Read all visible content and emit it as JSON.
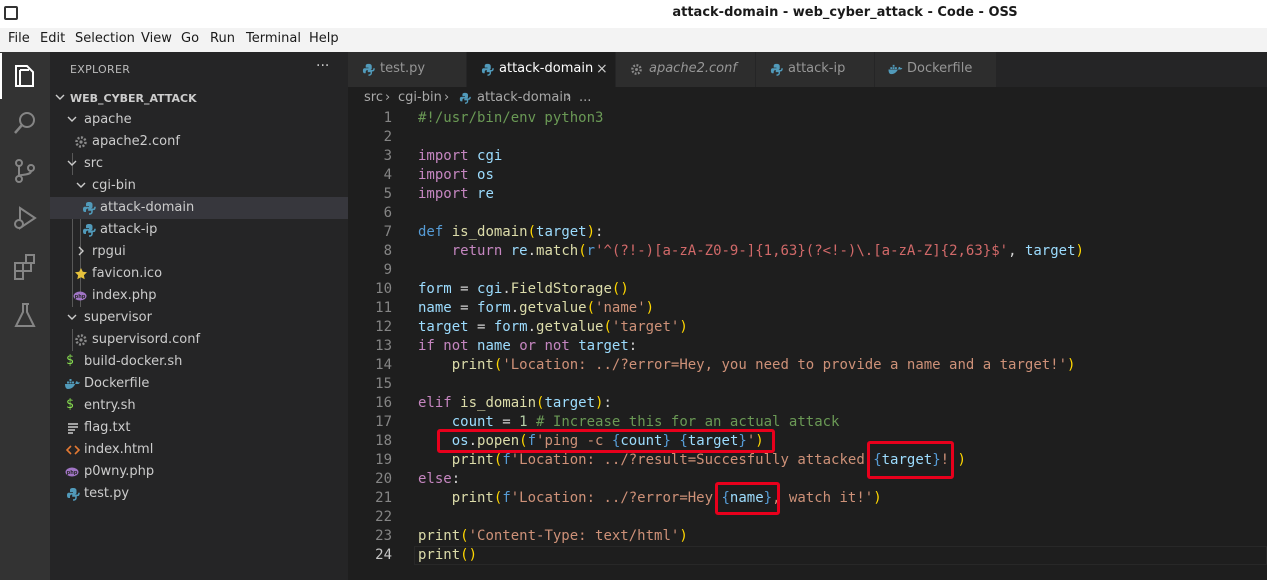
{
  "window": {
    "title": "attack-domain - web_cyber_attack - Code - OSS"
  },
  "menu": [
    "File",
    "Edit",
    "Selection",
    "View",
    "Go",
    "Run",
    "Terminal",
    "Help"
  ],
  "activity_bar": [
    "files-icon",
    "search-icon",
    "source-control-icon",
    "run-debug-icon",
    "extensions-icon",
    "testing-icon"
  ],
  "explorer": {
    "header": "EXPLORER",
    "more": "···",
    "project": "WEB_CYBER_ATTACK",
    "items": [
      {
        "label": "apache",
        "kind": "folder-open"
      },
      {
        "label": "apache2.conf",
        "kind": "gear"
      },
      {
        "label": "src",
        "kind": "folder-open"
      },
      {
        "label": "cgi-bin",
        "kind": "folder-open"
      },
      {
        "label": "attack-domain",
        "kind": "python",
        "selected": true
      },
      {
        "label": "attack-ip",
        "kind": "python"
      },
      {
        "label": "rpgui",
        "kind": "folder-closed"
      },
      {
        "label": "favicon.ico",
        "kind": "star"
      },
      {
        "label": "index.php",
        "kind": "php"
      },
      {
        "label": "supervisor",
        "kind": "folder-open"
      },
      {
        "label": "supervisord.conf",
        "kind": "gear"
      },
      {
        "label": "build-docker.sh",
        "kind": "shell"
      },
      {
        "label": "Dockerfile",
        "kind": "docker"
      },
      {
        "label": "entry.sh",
        "kind": "shell"
      },
      {
        "label": "flag.txt",
        "kind": "text"
      },
      {
        "label": "index.html",
        "kind": "html"
      },
      {
        "label": "p0wny.php",
        "kind": "php"
      },
      {
        "label": "test.py",
        "kind": "python"
      }
    ]
  },
  "tabs": [
    {
      "label": "test.py",
      "icon": "python",
      "active": false
    },
    {
      "label": "attack-domain",
      "icon": "python",
      "active": true,
      "close": "×"
    },
    {
      "label": "apache2.conf",
      "icon": "gear",
      "active": false,
      "italic": true
    },
    {
      "label": "attack-ip",
      "icon": "python",
      "active": false
    },
    {
      "label": "Dockerfile",
      "icon": "docker",
      "active": false
    }
  ],
  "breadcrumb": {
    "parts": [
      "src",
      "cgi-bin",
      "attack-domain",
      "..."
    ],
    "sep": "›"
  },
  "editor": {
    "current_line": 24,
    "line_numbers": [
      "1",
      "2",
      "3",
      "4",
      "5",
      "6",
      "7",
      "8",
      "9",
      "10",
      "11",
      "12",
      "13",
      "14",
      "15",
      "16",
      "17",
      "18",
      "19",
      "20",
      "21",
      "22",
      "23",
      "24"
    ],
    "lines": [
      "#!/usr/bin/env python3",
      "",
      "import cgi",
      "import os",
      "import re",
      "",
      "def is_domain(target):",
      "    return re.match(r'^(?!-)[a-zA-Z0-9-]{1,63}(?<!-)\\.[a-zA-Z]{2,63}$', target)",
      "",
      "form = cgi.FieldStorage()",
      "name = form.getvalue('name')",
      "target = form.getvalue('target')",
      "if not name or not target:",
      "    print('Location: ../?error=Hey, you need to provide a name and a target!')",
      "",
      "elif is_domain(target):",
      "    count = 1 # Increase this for an actual attack",
      "    os.popen(f'ping -c {count} {target}')",
      "    print(f'Location: ../?result=Succesfully attacked {target}!')",
      "else:",
      "    print(f'Location: ../?error=Hey {name}, watch it!')",
      "",
      "print('Content-Type: text/html')",
      "print()"
    ]
  },
  "highlight_color": "#e8001c"
}
